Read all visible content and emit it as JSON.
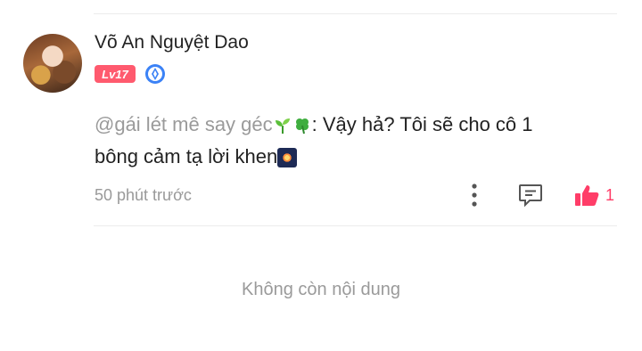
{
  "comment": {
    "username": "Võ An Nguyệt Dao",
    "level_badge": "Lv17",
    "mention": "@gái lét mê say géc",
    "text_part1": ": Vậy hả? Tôi sẽ cho cô 1",
    "text_part2": "bông cảm tạ lời khen",
    "time": "50 phút trước",
    "like_count": "1"
  },
  "footer": {
    "end_text": "Không còn nội dung"
  },
  "colors": {
    "accent": "#ff3d68",
    "level_badge": "#ff5a6e",
    "verify": "#3b82f6"
  }
}
